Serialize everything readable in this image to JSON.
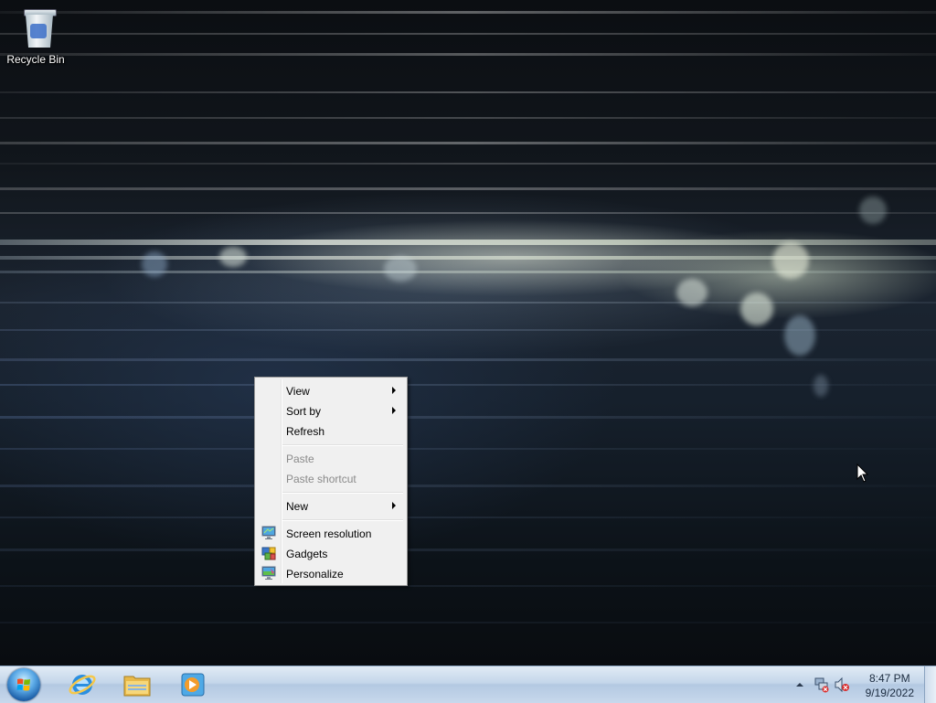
{
  "desktop": {
    "icons": [
      {
        "label": "Recycle Bin",
        "icon": "recycle-bin-icon"
      }
    ]
  },
  "context_menu": {
    "items": [
      {
        "label": "View",
        "submenu": true,
        "enabled": true
      },
      {
        "label": "Sort by",
        "submenu": true,
        "enabled": true
      },
      {
        "label": "Refresh",
        "submenu": false,
        "enabled": true
      },
      {
        "label": "Paste",
        "submenu": false,
        "enabled": false
      },
      {
        "label": "Paste shortcut",
        "submenu": false,
        "enabled": false
      },
      {
        "label": "New",
        "submenu": true,
        "enabled": true
      },
      {
        "label": "Screen resolution",
        "submenu": false,
        "enabled": true,
        "icon": "monitor-icon"
      },
      {
        "label": "Gadgets",
        "submenu": false,
        "enabled": true,
        "icon": "gadgets-icon"
      },
      {
        "label": "Personalize",
        "submenu": false,
        "enabled": true,
        "icon": "personalize-icon"
      }
    ]
  },
  "taskbar": {
    "start_button": "windows-logo-icon",
    "pinned": [
      "internet-explorer-icon",
      "windows-explorer-icon",
      "media-player-icon"
    ],
    "tray_icons": [
      "show-hidden-icons-arrow",
      "network-icon",
      "volume-muted-icon"
    ],
    "clock": {
      "time": "8:47 PM",
      "date": "9/19/2022"
    }
  }
}
